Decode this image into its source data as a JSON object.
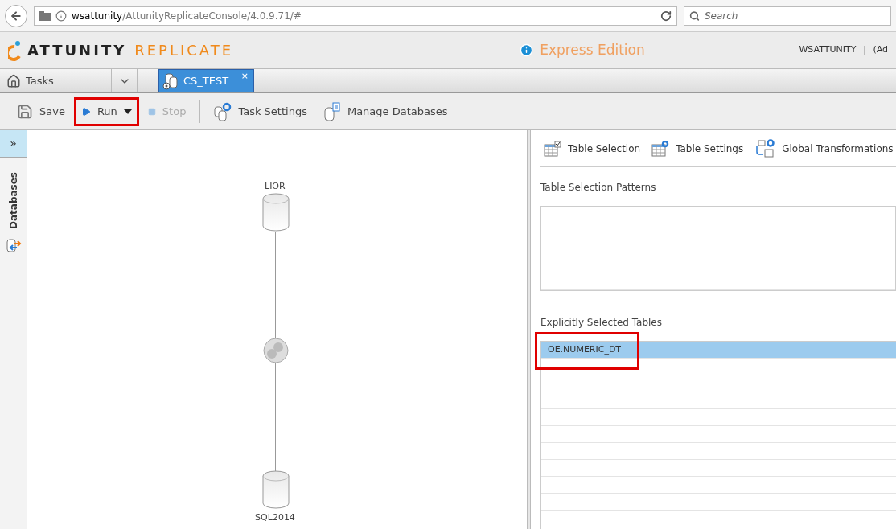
{
  "browser": {
    "address_host": "wsattunity",
    "address_path": "/AttunityReplicateConsole/4.0.9.71/#",
    "search_placeholder": "Search"
  },
  "header": {
    "logo_word_1": "ATTUNITY",
    "logo_word_2": "REPLICATE",
    "edition": "Express Edition",
    "user": "WSATTUNITY",
    "user_role": "(Ad"
  },
  "nav": {
    "home": "Tasks",
    "tabs": [
      {
        "label": "CS_TEST",
        "selected": true,
        "close": "×"
      }
    ]
  },
  "toolbar": [
    {
      "label": "Save",
      "kind": "save",
      "disabled": false,
      "highlighted": false
    },
    {
      "label": "Run",
      "kind": "run",
      "disabled": false,
      "highlighted": true
    },
    {
      "label": "Stop",
      "kind": "stop",
      "disabled": true,
      "highlighted": false
    },
    {
      "label": "Task Settings",
      "kind": "settings",
      "disabled": false,
      "highlighted": false
    },
    {
      "label": "Manage Databases",
      "kind": "databases",
      "disabled": false,
      "highlighted": false
    }
  ],
  "sidebar": {
    "toggle": "»",
    "label": "Databases"
  },
  "diagram": {
    "source": "LIOR",
    "target": "SQL2014"
  },
  "panel": {
    "tabs": [
      {
        "label": "Table Selection",
        "kind": "selection"
      },
      {
        "label": "Table Settings",
        "kind": "settings"
      },
      {
        "label": "Global Transformations",
        "kind": "transform"
      }
    ],
    "patterns_title": "Table Selection Patterns",
    "selected_title": "Explicitly Selected Tables",
    "tables": [
      {
        "name": "OE.NUMERIC_DT",
        "selected": true,
        "highlighted": true
      }
    ]
  }
}
